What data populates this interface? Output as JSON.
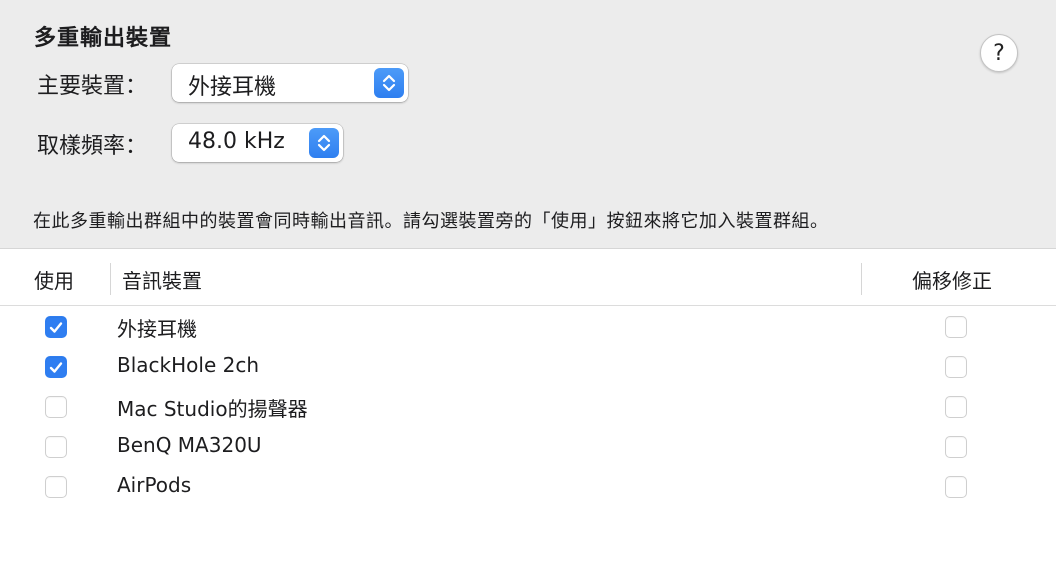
{
  "panel": {
    "title": "多重輸出裝置",
    "help_label": "?",
    "main_device": {
      "label": "主要裝置：",
      "value": "外接耳機"
    },
    "sample_rate": {
      "label": "取樣頻率：",
      "value": "48.0 kHz"
    },
    "description": "在此多重輸出群組中的裝置會同時輸出音訊。請勾選裝置旁的「使用」按鈕來將它加入裝置群組。"
  },
  "table": {
    "headers": {
      "use": "使用",
      "device": "音訊裝置",
      "drift": "偏移修正"
    },
    "rows": [
      {
        "name": "外接耳機",
        "use": true,
        "drift": false
      },
      {
        "name": "BlackHole 2ch",
        "use": true,
        "drift": false
      },
      {
        "name": "Mac Studio的揚聲器",
        "use": false,
        "drift": false
      },
      {
        "name": "BenQ MA320U",
        "use": false,
        "drift": false
      },
      {
        "name": "AirPods",
        "use": false,
        "drift": false
      }
    ]
  },
  "colors": {
    "accent": "#2f7ef1",
    "panel_bg": "#ececec",
    "table_bg": "#ffffff"
  },
  "icons": {
    "stepper": "chevron-up-down-icon",
    "check": "checkmark-icon"
  }
}
